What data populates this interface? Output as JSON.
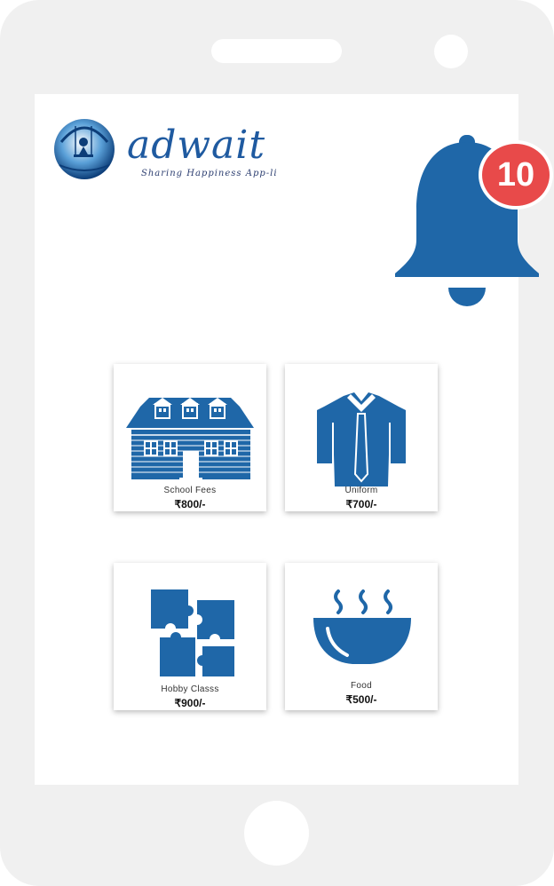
{
  "app": {
    "logo_word": "adwait",
    "tagline": "Sharing Happiness App-li"
  },
  "notifications": {
    "count": "10",
    "icon": "bell-icon",
    "badge_color": "#e84a4a"
  },
  "colors": {
    "brand_blue": "#1f67a8",
    "phone_frame": "#f0f0f0"
  },
  "items": [
    {
      "label": "School Fees",
      "price": "₹800/-",
      "icon": "school-building-icon"
    },
    {
      "label": "Uniform",
      "price": "₹700/-",
      "icon": "shirt-tie-icon"
    },
    {
      "label": "Hobby Classs",
      "price": "₹900/-",
      "icon": "puzzle-icon"
    },
    {
      "label": "Food",
      "price": "₹500/-",
      "icon": "food-bowl-icon"
    }
  ]
}
